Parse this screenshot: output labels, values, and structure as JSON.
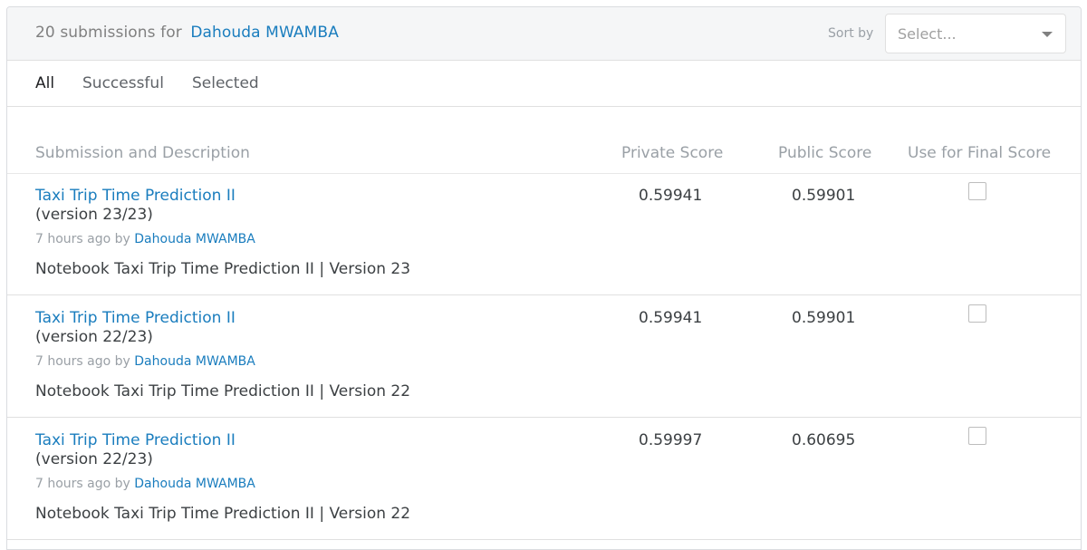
{
  "header": {
    "count_text": "20 submissions for",
    "user_name": "Dahouda MWAMBA",
    "sort_label": "Sort by",
    "sort_placeholder": "Select..."
  },
  "tabs": [
    {
      "label": "All",
      "active": true
    },
    {
      "label": "Successful",
      "active": false
    },
    {
      "label": "Selected",
      "active": false
    }
  ],
  "columns": {
    "submission": "Submission and Description",
    "private": "Private Score",
    "public": "Public Score",
    "final": "Use for Final Score"
  },
  "submissions": [
    {
      "title": "Taxi Trip Time Prediction II",
      "version": "(version 23/23)",
      "time": "7 hours ago by",
      "author": "Dahouda MWAMBA",
      "description": "Notebook Taxi Trip Time Prediction II | Version 23",
      "private_score": "0.59941",
      "public_score": "0.59901",
      "selected": false
    },
    {
      "title": "Taxi Trip Time Prediction II",
      "version": "(version 22/23)",
      "time": "7 hours ago by",
      "author": "Dahouda MWAMBA",
      "description": "Notebook Taxi Trip Time Prediction II | Version 22",
      "private_score": "0.59941",
      "public_score": "0.59901",
      "selected": false
    },
    {
      "title": "Taxi Trip Time Prediction II",
      "version": "(version 22/23)",
      "time": "7 hours ago by",
      "author": "Dahouda MWAMBA",
      "description": "Notebook Taxi Trip Time Prediction II | Version 22",
      "private_score": "0.59997",
      "public_score": "0.60695",
      "selected": false
    }
  ]
}
